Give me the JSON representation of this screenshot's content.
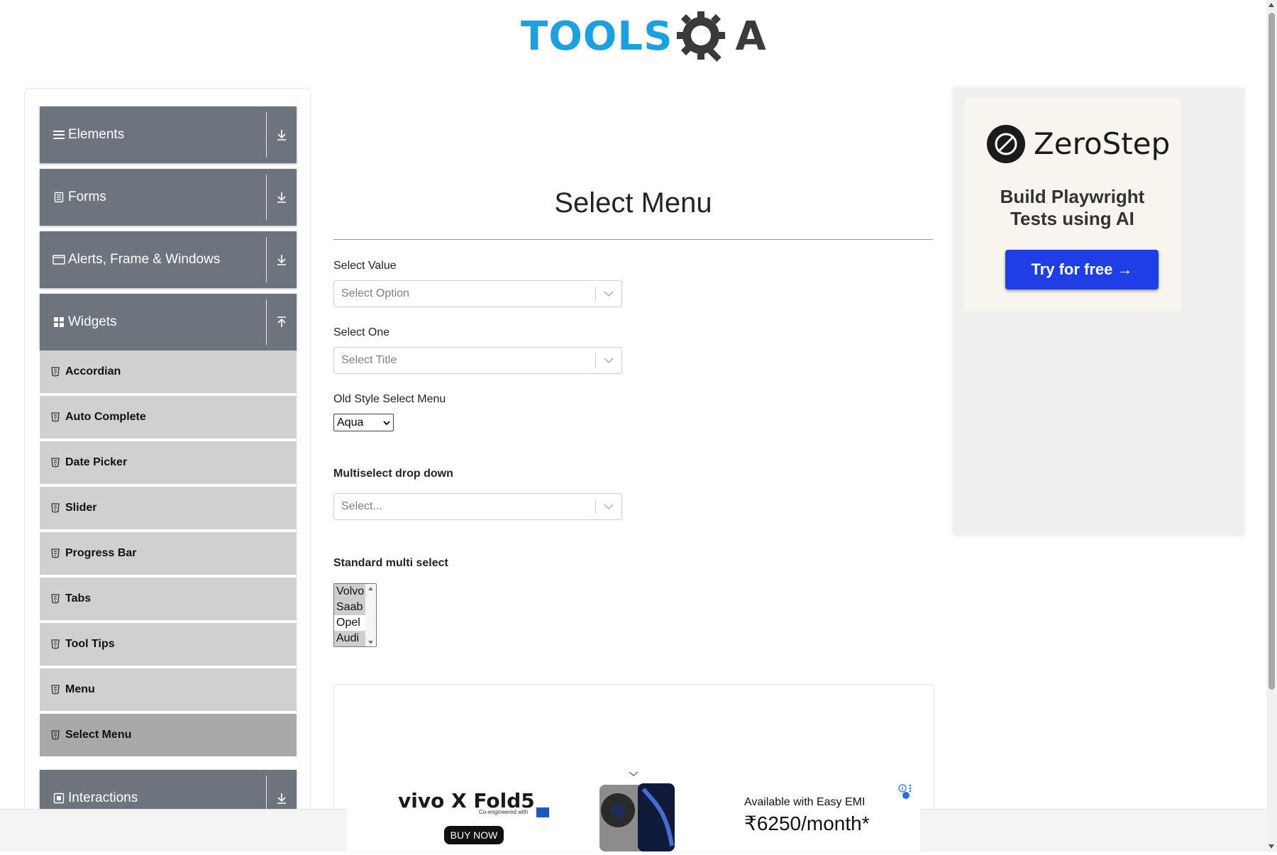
{
  "logo": {
    "text": "TOOLS",
    "suffix": "A"
  },
  "sidebar": {
    "groups": [
      {
        "label": "Elements",
        "icon": "hamburger-icon",
        "state": "collapsed"
      },
      {
        "label": "Forms",
        "icon": "document-icon",
        "state": "collapsed"
      },
      {
        "label": "Alerts, Frame & Windows",
        "icon": "window-icon",
        "state": "collapsed"
      },
      {
        "label": "Widgets",
        "icon": "grid-icon",
        "state": "expanded"
      },
      {
        "label": "Interactions",
        "icon": "box-icon",
        "state": "collapsed"
      }
    ],
    "widget_items": [
      {
        "label": "Accordian"
      },
      {
        "label": "Auto Complete"
      },
      {
        "label": "Date Picker"
      },
      {
        "label": "Slider"
      },
      {
        "label": "Progress Bar"
      },
      {
        "label": "Tabs"
      },
      {
        "label": "Tool Tips"
      },
      {
        "label": "Menu"
      },
      {
        "label": "Select Menu",
        "active": true
      }
    ]
  },
  "main": {
    "title": "Select Menu",
    "select_value": {
      "label": "Select Value",
      "placeholder": "Select Option"
    },
    "select_one": {
      "label": "Select One",
      "placeholder": "Select Title"
    },
    "old_style": {
      "label": "Old Style Select Menu",
      "value": "Aqua"
    },
    "multiselect": {
      "label": "Multiselect drop down",
      "placeholder": "Select..."
    },
    "standard_multi": {
      "label": "Standard multi select",
      "options": [
        {
          "text": "Volvo",
          "selected": true
        },
        {
          "text": "Saab",
          "selected": true
        },
        {
          "text": "Opel",
          "selected": false
        },
        {
          "text": "Audi",
          "selected": true
        }
      ]
    }
  },
  "right_ad": {
    "brand": "ZeroStep",
    "tagline_line1": "Build Playwright",
    "tagline_line2": "Tests using AI",
    "cta": "Try for free →",
    "accent": "#1f3ee6"
  },
  "bottom_ad": {
    "brand": "vivo X Fold5",
    "sub": "Co-engineered with",
    "buy": "BUY NOW",
    "emi": "Available with Easy EMI",
    "price": "₹6250/month*"
  },
  "colors": {
    "sidebar_header": "#6c757d",
    "sidebar_item": "#d0d0d0",
    "sidebar_item_active": "#a9a9a9",
    "logo_blue": "#1ba1e2"
  }
}
